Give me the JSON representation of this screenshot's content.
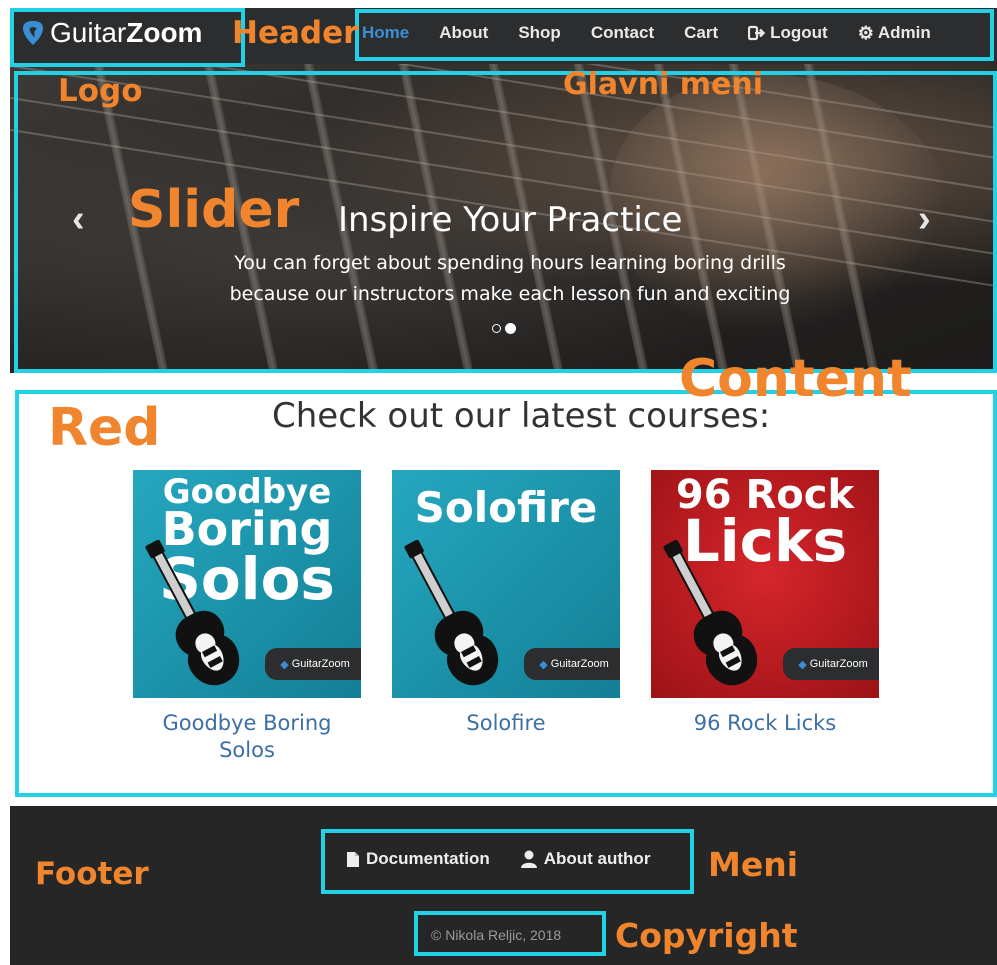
{
  "brand": {
    "name_light": "Guitar",
    "name_bold": "Zoom"
  },
  "nav": {
    "items": [
      {
        "label": "Home",
        "active": true
      },
      {
        "label": "About"
      },
      {
        "label": "Shop"
      },
      {
        "label": "Contact"
      },
      {
        "label": "Cart"
      },
      {
        "label": "Logout",
        "icon": "logout-icon"
      },
      {
        "label": "Admin",
        "icon": "gear-icon"
      }
    ]
  },
  "slider": {
    "title": "Inspire Your Practice",
    "text": "You can forget about spending hours learning boring drills because our instructors make each lesson fun and exciting",
    "prev_label": "‹",
    "next_label": "›",
    "slide_count": 2,
    "active_slide": 2
  },
  "content": {
    "heading": "Check out our latest courses:",
    "courses": [
      {
        "cover_line1": "Goodbye",
        "cover_line2": "Boring",
        "cover_line3": "Solos",
        "badge": "GuitarZoom",
        "label": "Goodbye Boring Solos",
        "bg": "#1a9bb3"
      },
      {
        "cover_line1": "Solofire",
        "cover_line2": "",
        "cover_line3": "",
        "badge": "GuitarZoom",
        "label": "Solofire",
        "bg": "#1a9bb3"
      },
      {
        "cover_line1": "96 Rock",
        "cover_line2": "Licks",
        "cover_line3": "",
        "badge": "GuitarZoom",
        "label": "96 Rock Licks",
        "bg": "#b5161b"
      }
    ]
  },
  "footer": {
    "links": [
      {
        "label": "Documentation",
        "icon": "document-icon"
      },
      {
        "label": "About author",
        "icon": "user-icon"
      }
    ],
    "copyright": "© Nikola Reljic, 2018"
  },
  "annotations": {
    "header": "Header",
    "logo": "Logo",
    "main_menu": "Glavni meni",
    "slider": "Slider",
    "content": "Content",
    "row": "Red",
    "footer": "Footer",
    "menu": "Meni",
    "copyright": "Copyright"
  },
  "colors": {
    "outline": "#22d1e6",
    "annotation": "#f0852d",
    "link": "#3d6fa5",
    "active_nav": "#3b8ed6",
    "dark": "#262626"
  }
}
